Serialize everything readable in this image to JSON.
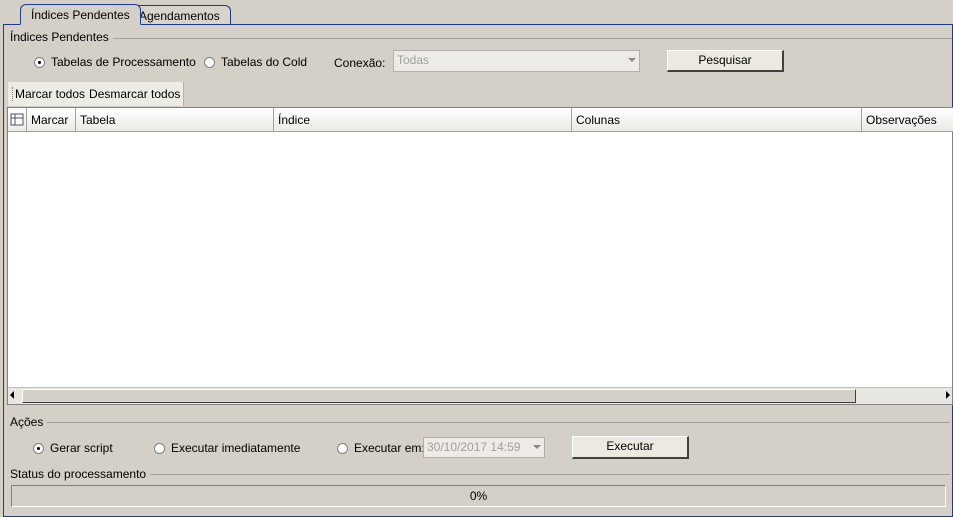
{
  "tabs": [
    {
      "label": "Índices Pendentes",
      "active": true
    },
    {
      "label": "Agendamentos",
      "active": false
    }
  ],
  "indices": {
    "group_label": "Índices Pendentes",
    "radio_processamento": "Tabelas de Processamento",
    "radio_cold": "Tabelas do Cold",
    "conexao_label": "Conexão:",
    "conexao_value": "Todas",
    "pesquisar": "Pesquisar"
  },
  "toolbar": {
    "marcar_todos": "Marcar todos",
    "desmarcar_todos": "Desmarcar todos"
  },
  "grid": {
    "columns": [
      "Marcar",
      "Tabela",
      "Índice",
      "Colunas",
      "Observações"
    ],
    "rows": []
  },
  "acoes": {
    "group_label": "Ações",
    "gerar_script": "Gerar script",
    "executar_imediatamente": "Executar imediatamente",
    "executar_em": "Executar em:",
    "data_value": "30/10/2017 14:59",
    "executar": "Executar"
  },
  "status": {
    "group_label": "Status do processamento",
    "progress_text": "0%",
    "progress": 0
  }
}
